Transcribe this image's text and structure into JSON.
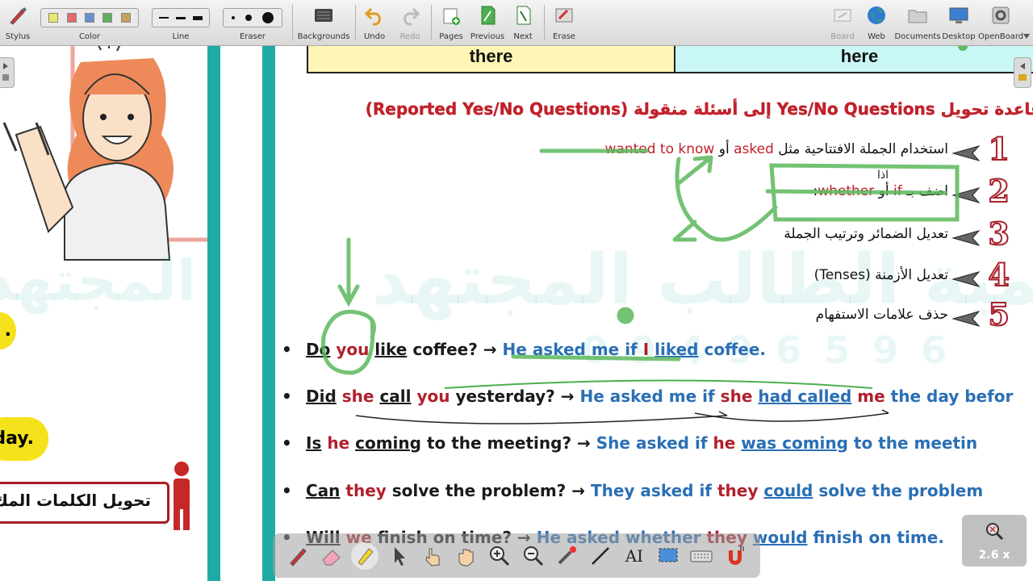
{
  "toolbar": {
    "left_tools": [
      {
        "label": "Stylus",
        "icon": "stylus-icon"
      },
      {
        "label": "Color",
        "icon": "color-palette"
      },
      {
        "label": "Line",
        "icon": "line-width"
      },
      {
        "label": "Eraser",
        "icon": "eraser-size"
      },
      {
        "label": "Backgrounds",
        "icon": "backgrounds-icon"
      },
      {
        "label": "Undo",
        "icon": "undo-icon"
      },
      {
        "label": "Redo",
        "icon": "redo-icon"
      },
      {
        "label": "Pages",
        "icon": "pages-icon"
      },
      {
        "label": "Previous",
        "icon": "previous-icon"
      },
      {
        "label": "Next",
        "icon": "next-icon"
      },
      {
        "label": "Erase",
        "icon": "erase-icon"
      }
    ],
    "right_tools": [
      {
        "label": "Board",
        "icon": "board-icon"
      },
      {
        "label": "Web",
        "icon": "web-globe-icon"
      },
      {
        "label": "Documents",
        "icon": "documents-folder-icon"
      },
      {
        "label": "Desktop",
        "icon": "desktop-monitor-icon"
      },
      {
        "label": "OpenBoard",
        "icon": "openboard-gear-icon"
      }
    ],
    "color_swatches": [
      "#e8e86a",
      "#e06b6b",
      "#6a8fd0",
      "#5fae5f",
      "#c8a060"
    ]
  },
  "table": {
    "left_cell": "there",
    "right_cell": "here",
    "left_color": "#fdf6b5",
    "right_color": "#c9f7f5"
  },
  "rule_title": "قاعدة تحويل Yes/No Questions إلى أسئلة منقولة (Reported Yes/No Questions)",
  "steps": [
    {
      "num": "1",
      "text_ar": "استخدام الجملة الافتتاحية مثل",
      "kw1": "asked",
      "or": "أو",
      "kw2": "wanted to know"
    },
    {
      "num": "2",
      "text_ar": "اضف بـ",
      "kw1": "if",
      "or": "أو",
      "kw2": "whether",
      "suffix": ":",
      "handwritten": "اذا"
    },
    {
      "num": "3",
      "text_ar": "تعديل الضمائر وترتيب الجملة"
    },
    {
      "num": "4",
      "text_ar": "تعديل الأزمنة (Tenses)"
    },
    {
      "num": "5",
      "text_ar": "حذف علامات الاستفهام"
    }
  ],
  "sentences": [
    {
      "q_aux": "Do",
      "q_subj": "you",
      "q_verb": "like",
      "q_rest": "coffee?",
      "arrow": "→",
      "r_intro": "He asked me if",
      "r_subj": "I",
      "r_verb": "liked",
      "r_rest": "coffee."
    },
    {
      "q_aux": "Did",
      "q_subj": "she",
      "q_verb": "call",
      "q_obj": "you",
      "q_rest": "yesterday?",
      "arrow": "→",
      "r_intro": "He asked me if",
      "r_subj": "she",
      "r_verb": "had called",
      "r_obj": "me",
      "r_rest": "the day befor"
    },
    {
      "q_aux": "Is",
      "q_subj": "he",
      "q_verb": "coming",
      "q_rest": "to the meeting?",
      "arrow": "→",
      "r_intro": "She asked if",
      "r_subj": "he",
      "r_verb": "was coming",
      "r_rest": "to the meetin"
    },
    {
      "q_aux": "Can",
      "q_subj": "they",
      "q_verb": "solve",
      "q_rest": "the problem?",
      "arrow": "→",
      "r_intro": "They asked if",
      "r_subj": "they",
      "r_verb": "could",
      "r_rest": "solve the problem"
    },
    {
      "q_aux": "Will",
      "q_subj": "we",
      "q_verb": "finish",
      "q_rest": "on time?",
      "arrow": "→",
      "r_intro": "He asked whether",
      "r_subj": "they",
      "r_verb": "would",
      "r_rest": "finish on time."
    }
  ],
  "left_panel": {
    "banner_text": "تحويل الكلمات المك",
    "bubble_text": "day.",
    "dot_text": "."
  },
  "watermark": {
    "text": "أكاديمية الطالب المجتهد",
    "number": "0 9 4 9 6 5 9 6"
  },
  "zoom": {
    "label": "2.6 x"
  },
  "annot_tools": [
    "pen-icon",
    "eraser-icon",
    "highlighter-icon",
    "pointer-icon",
    "hand-pointer-icon",
    "hand-grab-icon",
    "zoom-in-icon",
    "zoom-out-icon",
    "laser-pointer-icon",
    "line-tool-icon",
    "text-tool-icon",
    "capture-icon",
    "keyboard-icon",
    "magnet-icon"
  ],
  "text_tool_glyph": "AI"
}
